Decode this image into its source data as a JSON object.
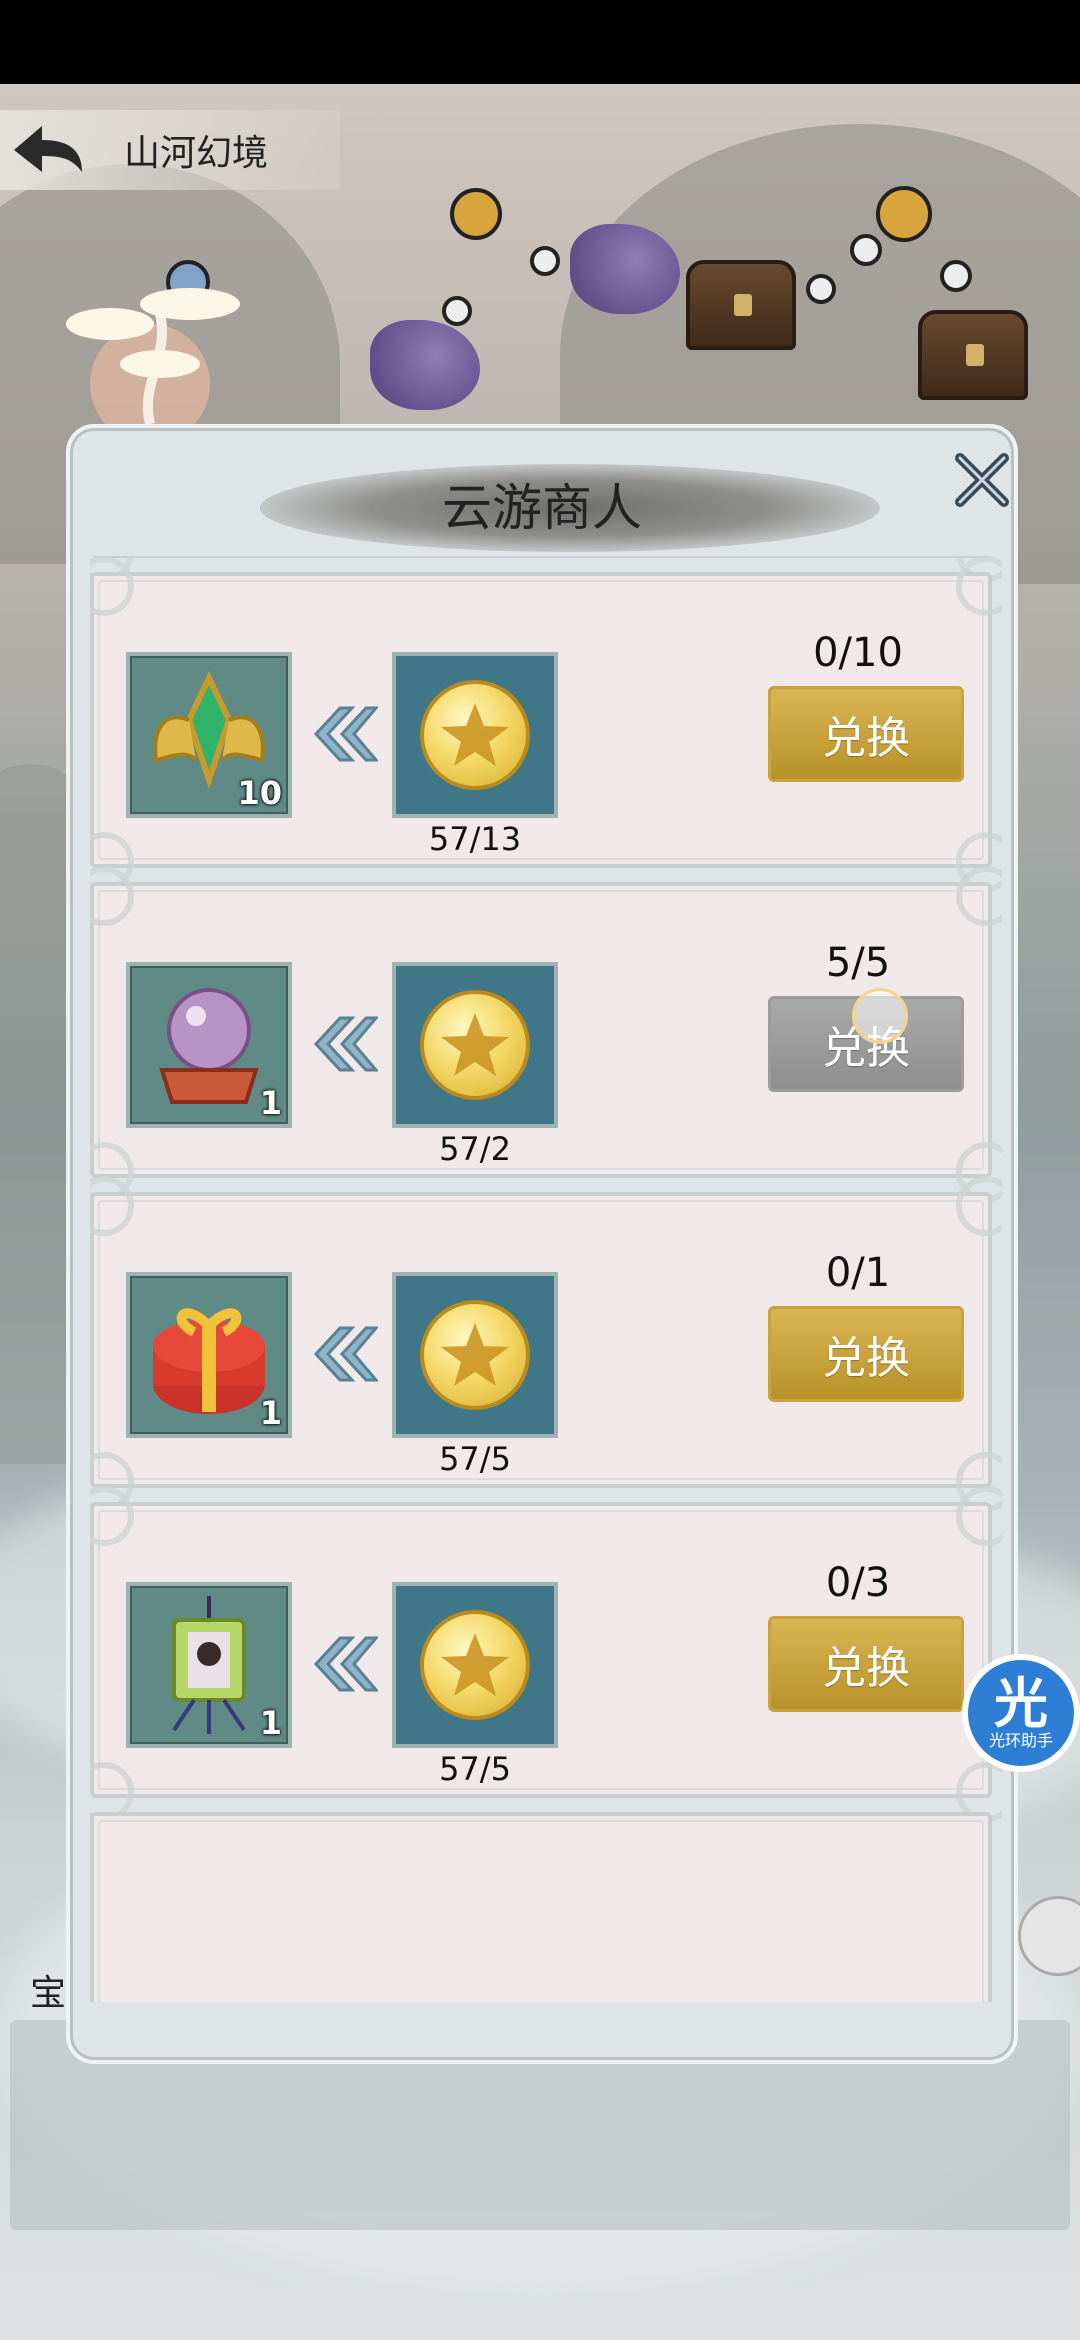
{
  "nav": {
    "title": "山河幻境",
    "back_icon": "back-arrow-icon"
  },
  "background": {
    "partial_label": "宝"
  },
  "helper": {
    "big": "光",
    "small": "光环助手"
  },
  "dialog": {
    "title": "云游商人",
    "items": [
      {
        "icon": "meat-crystals-icon",
        "qty": "10",
        "cost": "57/13",
        "limit": "",
        "button": "兑换",
        "enabled": true
      },
      {
        "icon": "golden-emblem-icon",
        "qty": "10",
        "cost": "57/13",
        "limit": "0/10",
        "button": "兑换",
        "enabled": true
      },
      {
        "icon": "crystal-orb-icon",
        "qty": "1",
        "cost": "57/2",
        "limit": "5/5",
        "button": "兑换",
        "enabled": false
      },
      {
        "icon": "gift-box-icon",
        "qty": "1",
        "cost": "57/5",
        "limit": "0/1",
        "button": "兑换",
        "enabled": true
      },
      {
        "icon": "jade-pendant-icon",
        "qty": "1",
        "cost": "57/5",
        "limit": "0/3",
        "button": "兑换",
        "enabled": true
      }
    ]
  },
  "colors": {
    "button_gold": "#c9a23f",
    "button_disabled": "#9c9c9c",
    "card_bg": "#f1e8ea",
    "slot_teal": "#3f7788"
  }
}
